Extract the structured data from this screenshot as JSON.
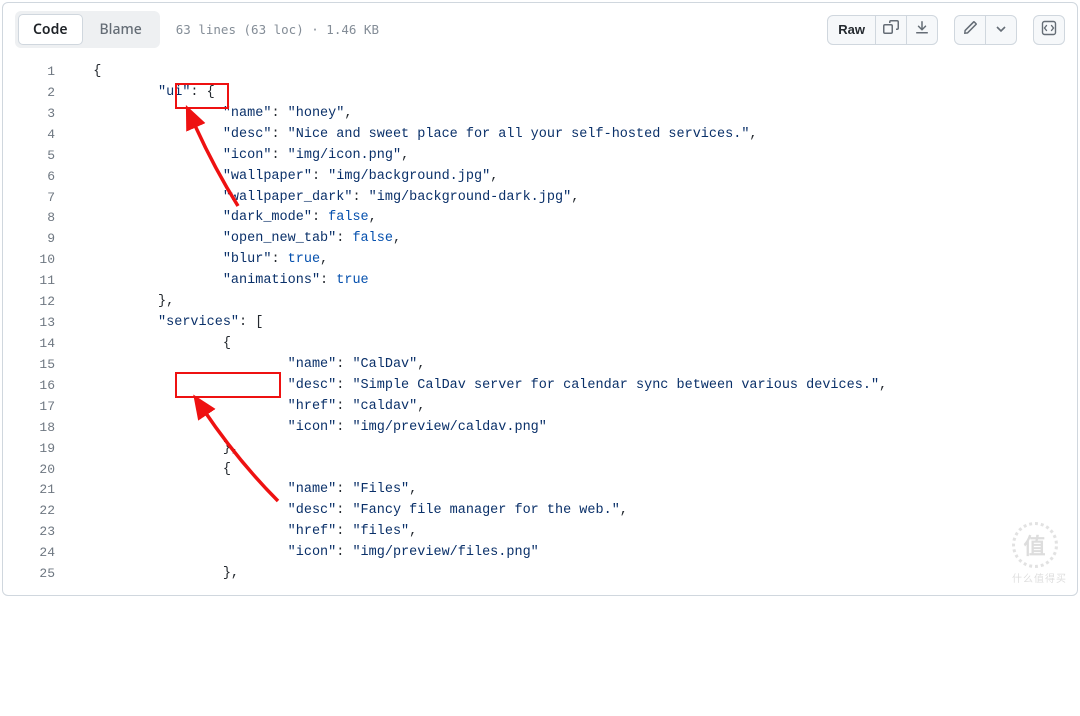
{
  "toolbar": {
    "tabs": {
      "code": "Code",
      "blame": "Blame"
    },
    "meta": "63 lines (63 loc) · 1.46 KB",
    "raw": "Raw"
  },
  "code": {
    "lines": [
      {
        "n": 1,
        "indent": 2,
        "segs": [
          {
            "t": "{",
            "c": "p"
          }
        ]
      },
      {
        "n": 2,
        "indent": 10,
        "segs": [
          {
            "t": "\"ui\"",
            "c": "k"
          },
          {
            "t": ": {",
            "c": "p"
          }
        ]
      },
      {
        "n": 3,
        "indent": 18,
        "segs": [
          {
            "t": "\"name\"",
            "c": "k"
          },
          {
            "t": ": ",
            "c": "p"
          },
          {
            "t": "\"honey\"",
            "c": "s"
          },
          {
            "t": ",",
            "c": "p"
          }
        ]
      },
      {
        "n": 4,
        "indent": 18,
        "segs": [
          {
            "t": "\"desc\"",
            "c": "k"
          },
          {
            "t": ": ",
            "c": "p"
          },
          {
            "t": "\"Nice and sweet place for all your self-hosted services.\"",
            "c": "s"
          },
          {
            "t": ",",
            "c": "p"
          }
        ]
      },
      {
        "n": 5,
        "indent": 18,
        "segs": [
          {
            "t": "\"icon\"",
            "c": "k"
          },
          {
            "t": ": ",
            "c": "p"
          },
          {
            "t": "\"img/icon.png\"",
            "c": "s"
          },
          {
            "t": ",",
            "c": "p"
          }
        ]
      },
      {
        "n": 6,
        "indent": 18,
        "segs": [
          {
            "t": "\"wallpaper\"",
            "c": "k"
          },
          {
            "t": ": ",
            "c": "p"
          },
          {
            "t": "\"img/background.jpg\"",
            "c": "s"
          },
          {
            "t": ",",
            "c": "p"
          }
        ]
      },
      {
        "n": 7,
        "indent": 18,
        "segs": [
          {
            "t": "\"wallpaper_dark\"",
            "c": "k"
          },
          {
            "t": ": ",
            "c": "p"
          },
          {
            "t": "\"img/background-dark.jpg\"",
            "c": "s"
          },
          {
            "t": ",",
            "c": "p"
          }
        ]
      },
      {
        "n": 8,
        "indent": 18,
        "segs": [
          {
            "t": "\"dark_mode\"",
            "c": "k"
          },
          {
            "t": ": ",
            "c": "p"
          },
          {
            "t": "false",
            "c": "b"
          },
          {
            "t": ",",
            "c": "p"
          }
        ]
      },
      {
        "n": 9,
        "indent": 18,
        "segs": [
          {
            "t": "\"open_new_tab\"",
            "c": "k"
          },
          {
            "t": ": ",
            "c": "p"
          },
          {
            "t": "false",
            "c": "b"
          },
          {
            "t": ",",
            "c": "p"
          }
        ]
      },
      {
        "n": 10,
        "indent": 18,
        "segs": [
          {
            "t": "\"blur\"",
            "c": "k"
          },
          {
            "t": ": ",
            "c": "p"
          },
          {
            "t": "true",
            "c": "b"
          },
          {
            "t": ",",
            "c": "p"
          }
        ]
      },
      {
        "n": 11,
        "indent": 18,
        "segs": [
          {
            "t": "\"animations\"",
            "c": "k"
          },
          {
            "t": ": ",
            "c": "p"
          },
          {
            "t": "true",
            "c": "b"
          }
        ]
      },
      {
        "n": 12,
        "indent": 10,
        "segs": [
          {
            "t": "},",
            "c": "p"
          }
        ]
      },
      {
        "n": 13,
        "indent": 10,
        "segs": [
          {
            "t": "\"services\"",
            "c": "k"
          },
          {
            "t": ": [",
            "c": "p"
          }
        ]
      },
      {
        "n": 14,
        "indent": 18,
        "segs": [
          {
            "t": "{",
            "c": "p"
          }
        ]
      },
      {
        "n": 15,
        "indent": 26,
        "segs": [
          {
            "t": "\"name\"",
            "c": "k"
          },
          {
            "t": ": ",
            "c": "p"
          },
          {
            "t": "\"CalDav\"",
            "c": "s"
          },
          {
            "t": ",",
            "c": "p"
          }
        ]
      },
      {
        "n": 16,
        "indent": 26,
        "segs": [
          {
            "t": "\"desc\"",
            "c": "k"
          },
          {
            "t": ": ",
            "c": "p"
          },
          {
            "t": "\"Simple CalDav server for calendar sync between various devices.\"",
            "c": "s"
          },
          {
            "t": ",",
            "c": "p"
          }
        ]
      },
      {
        "n": 17,
        "indent": 26,
        "segs": [
          {
            "t": "\"href\"",
            "c": "k"
          },
          {
            "t": ": ",
            "c": "p"
          },
          {
            "t": "\"caldav\"",
            "c": "s"
          },
          {
            "t": ",",
            "c": "p"
          }
        ]
      },
      {
        "n": 18,
        "indent": 26,
        "segs": [
          {
            "t": "\"icon\"",
            "c": "k"
          },
          {
            "t": ": ",
            "c": "p"
          },
          {
            "t": "\"img/preview/caldav.png\"",
            "c": "s"
          }
        ]
      },
      {
        "n": 19,
        "indent": 18,
        "segs": [
          {
            "t": "},",
            "c": "p"
          }
        ]
      },
      {
        "n": 20,
        "indent": 18,
        "segs": [
          {
            "t": "{",
            "c": "p"
          }
        ]
      },
      {
        "n": 21,
        "indent": 26,
        "segs": [
          {
            "t": "\"name\"",
            "c": "k"
          },
          {
            "t": ": ",
            "c": "p"
          },
          {
            "t": "\"Files\"",
            "c": "s"
          },
          {
            "t": ",",
            "c": "p"
          }
        ]
      },
      {
        "n": 22,
        "indent": 26,
        "segs": [
          {
            "t": "\"desc\"",
            "c": "k"
          },
          {
            "t": ": ",
            "c": "p"
          },
          {
            "t": "\"Fancy file manager for the web.\"",
            "c": "s"
          },
          {
            "t": ",",
            "c": "p"
          }
        ]
      },
      {
        "n": 23,
        "indent": 26,
        "segs": [
          {
            "t": "\"href\"",
            "c": "k"
          },
          {
            "t": ": ",
            "c": "p"
          },
          {
            "t": "\"files\"",
            "c": "s"
          },
          {
            "t": ",",
            "c": "p"
          }
        ]
      },
      {
        "n": 24,
        "indent": 26,
        "segs": [
          {
            "t": "\"icon\"",
            "c": "k"
          },
          {
            "t": ": ",
            "c": "p"
          },
          {
            "t": "\"img/preview/files.png\"",
            "c": "s"
          }
        ]
      },
      {
        "n": 25,
        "indent": 18,
        "segs": [
          {
            "t": "},",
            "c": "p"
          }
        ]
      }
    ]
  },
  "watermark": {
    "char": "值",
    "text": "什么值得买"
  }
}
